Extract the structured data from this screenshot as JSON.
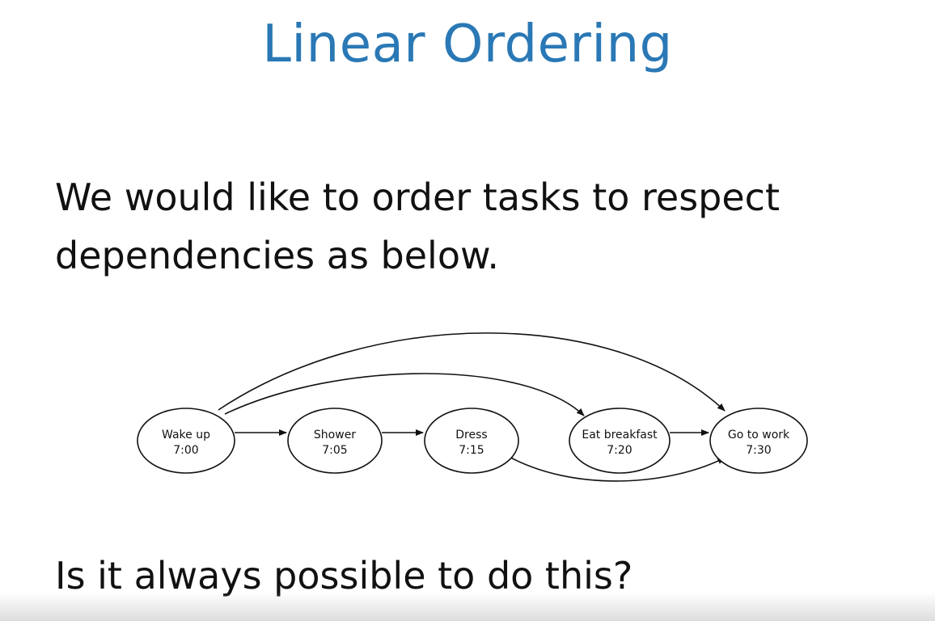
{
  "slide": {
    "title": "Linear Ordering",
    "body_line1": "We would like to order tasks to respect",
    "body_line2": "dependencies as below.",
    "question": "Is it always possible to do this?",
    "title_color": "#2a78b5"
  },
  "diagram": {
    "nodes": [
      {
        "id": "wake",
        "name": "Wake up",
        "time": "7:00"
      },
      {
        "id": "shower",
        "name": "Shower",
        "time": "7:05"
      },
      {
        "id": "dress",
        "name": "Dress",
        "time": "7:15"
      },
      {
        "id": "breakfast",
        "name": "Eat breakfast",
        "time": "7:20"
      },
      {
        "id": "work",
        "name": "Go to work",
        "time": "7:30"
      }
    ],
    "edges": [
      {
        "from": "wake",
        "to": "shower"
      },
      {
        "from": "shower",
        "to": "dress"
      },
      {
        "from": "breakfast",
        "to": "work"
      },
      {
        "from": "wake",
        "to": "work"
      },
      {
        "from": "wake",
        "to": "breakfast"
      },
      {
        "from": "dress",
        "to": "work"
      }
    ]
  }
}
